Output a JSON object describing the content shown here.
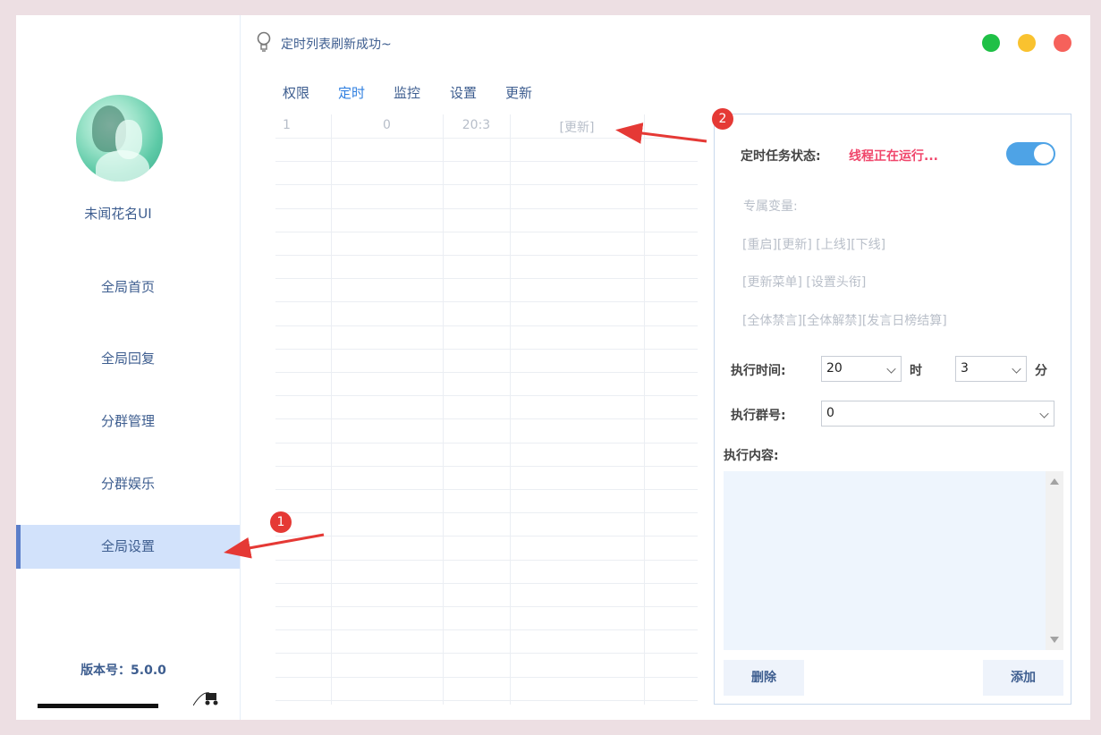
{
  "sidebar": {
    "username": "未闻花名UI",
    "nav": [
      "全局首页",
      "全局回复",
      "分群管理",
      "分群娱乐",
      "全局设置"
    ],
    "active_index": 4,
    "version": "版本号：5.0.0",
    "progress_fraction": 0.9
  },
  "header": {
    "status_icon": "lightbulb-icon",
    "status_text": "定时列表刷新成功~",
    "window_controls": {
      "green": "#1fc046",
      "yellow": "#f9c22f",
      "red": "#f6615b"
    }
  },
  "tabs": [
    "权限",
    "定时",
    "监控",
    "设置",
    "更新"
  ],
  "active_tab": 1,
  "table": {
    "rows": [
      [
        "1",
        "0",
        "20:3",
        "[更新]"
      ]
    ]
  },
  "panel": {
    "status_label": "定时任务状态:",
    "status_value": "线程正在运行...",
    "toggle_on": true,
    "var_title": "专属变量:",
    "var_line1": "[重启][更新] [上线][下线]",
    "var_line2": "[更新菜单] [设置头衔]",
    "var_line3": "[全体禁言][全体解禁][发言日榜结算]",
    "time_label": "执行时间:",
    "hour_value": "20",
    "hour_unit": "时",
    "minute_value": "3",
    "minute_unit": "分",
    "group_label": "执行群号:",
    "group_value": "0",
    "content_label": "执行内容:",
    "delete_button": "删除",
    "add_button": "添加"
  },
  "annotations": {
    "badge1": "1",
    "badge2": "2",
    "arrow_color": "#e53935"
  }
}
